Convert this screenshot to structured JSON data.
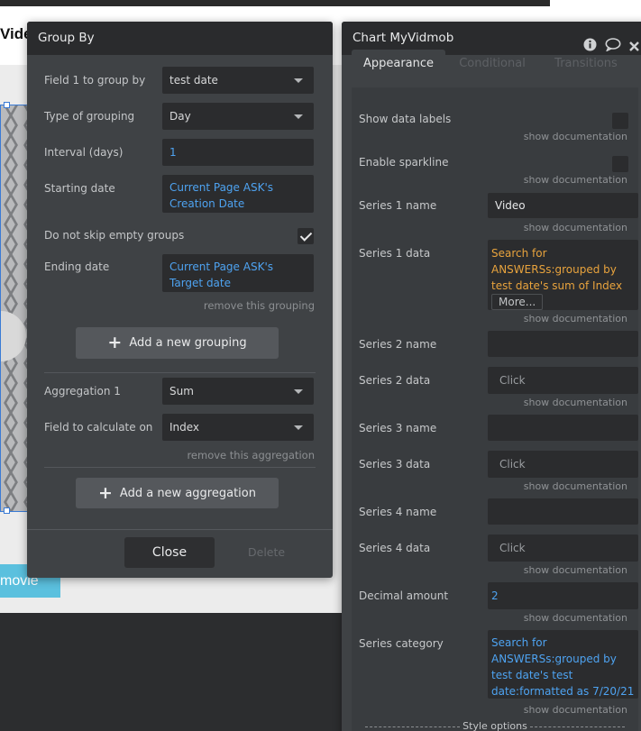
{
  "canvas": {
    "page_title": "Vide",
    "movie_button": "movie"
  },
  "group_by_panel": {
    "title": "Group By",
    "field1": {
      "label": "Field 1 to group by",
      "value": "test date"
    },
    "grouping_type": {
      "label": "Type of grouping",
      "value": "Day"
    },
    "interval": {
      "label": "Interval (days)",
      "value": "1"
    },
    "starting_date": {
      "label": "Starting date",
      "value": "Current Page ASK's Creation Date"
    },
    "skip_empty": {
      "label": "Do not skip empty groups",
      "checked": true
    },
    "ending_date": {
      "label": "Ending date",
      "value": "Current Page ASK's Target date"
    },
    "remove_grouping": "remove this grouping",
    "add_grouping": "Add a new grouping",
    "aggregation": {
      "label": "Aggregation 1",
      "value": "Sum"
    },
    "calc_field": {
      "label": "Field to calculate on",
      "value": "Index"
    },
    "remove_aggregation": "remove this aggregation",
    "add_aggregation": "Add a new aggregation",
    "close": "Close",
    "delete": "Delete"
  },
  "chart_panel": {
    "title": "Chart MyVidmob",
    "icons": [
      "info-icon",
      "comment-icon",
      "close-icon"
    ],
    "tabs": [
      {
        "label": "Appearance",
        "active": true
      },
      {
        "label": "Conditional",
        "active": false
      },
      {
        "label": "Transitions",
        "active": false
      }
    ],
    "show_doc": "show documentation",
    "show_data_labels": {
      "label": "Show data labels",
      "checked": false
    },
    "enable_sparkline": {
      "label": "Enable sparkline",
      "checked": false
    },
    "series1_name": {
      "label": "Series 1 name",
      "value": "Video"
    },
    "series1_data": {
      "label": "Series 1 data",
      "value": "Search for ANSWERSs:grouped by test date's sum of Index",
      "more": "More..."
    },
    "series2_name": {
      "label": "Series 2 name",
      "value": ""
    },
    "series2_data": {
      "label": "Series 2 data",
      "placeholder": "Click"
    },
    "series3_name": {
      "label": "Series 3 name",
      "value": ""
    },
    "series3_data": {
      "label": "Series 3 data",
      "placeholder": "Click"
    },
    "series4_name": {
      "label": "Series 4 name",
      "value": ""
    },
    "series4_data": {
      "label": "Series 4 data",
      "placeholder": "Click"
    },
    "decimal_amount": {
      "label": "Decimal amount",
      "value": "2"
    },
    "series_category": {
      "label": "Series category",
      "value": "Search for ANSWERSs:grouped by test date's test date:formatted as 7/20/21"
    },
    "style_options": "Style options"
  },
  "colors": {
    "panel_bg": "#3f4245",
    "header_bg": "#2a2b2d",
    "field_bg": "#2b2c2e",
    "dynamic_blue": "#4ea3f1",
    "dynamic_orange": "#e8a33d",
    "movie_button": "#5bc0de"
  }
}
